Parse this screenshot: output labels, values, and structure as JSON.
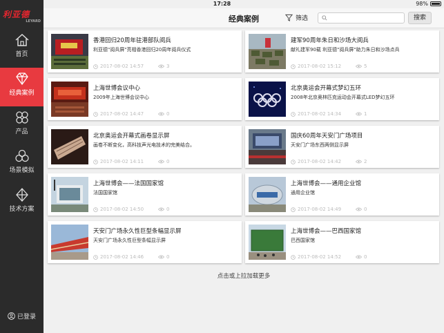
{
  "status": {
    "carrier": "iPad",
    "time": "17:28",
    "battery": "98%"
  },
  "brand": {
    "name_cn": "利亚德",
    "name_en": "LEYARD"
  },
  "sidebar": {
    "items": [
      {
        "label": "首页",
        "icon": "home-icon"
      },
      {
        "label": "经典案例",
        "icon": "diamond-icon",
        "active": true
      },
      {
        "label": "产品",
        "icon": "grid-flower-icon"
      },
      {
        "label": "场景模拟",
        "icon": "circles-icon"
      },
      {
        "label": "技术方案",
        "icon": "layers-icon"
      }
    ],
    "login_label": "已登录"
  },
  "header": {
    "title": "经典案例",
    "filter_label": "筛选",
    "search_placeholder": "",
    "search_button": "搜索"
  },
  "cards": [
    {
      "title": "香港回归20周年驻港部队阅兵",
      "desc": "利亚德\"阅兵屏\"亮相香港回归20周年阅兵仪式",
      "date": "2017-08-02 14:57",
      "views": "3",
      "thumb": "parade-hk"
    },
    {
      "title": "建军90周年朱日和沙场大阅兵",
      "desc": "献礼建军90载 利亚德\"阅兵屏\"助力朱日和沙场点兵",
      "date": "2017-08-02 15:12",
      "views": "5",
      "thumb": "tanks"
    },
    {
      "title": "上海世博会议中心",
      "desc": "2009年上海世博会议中心",
      "date": "2017-08-02 14:47",
      "views": "0",
      "thumb": "conference"
    },
    {
      "title": "北京奥运会开幕式梦幻五环",
      "desc": "2008年北京奥林匹克运动会开幕式LED梦幻五环",
      "date": "2017-08-02 14:34",
      "views": "1",
      "thumb": "olympic-rings"
    },
    {
      "title": "北京奥运会开幕式画卷显示屏",
      "desc": "画卷不断变化，高科技声光电技术的完美结合。",
      "date": "2017-08-02 14:11",
      "views": "0",
      "thumb": "scroll"
    },
    {
      "title": "国庆60周年天安门广场项目",
      "desc": "天安门广场东西两侧显示屏",
      "date": "2017-08-02 14:42",
      "views": "2",
      "thumb": "tiananmen"
    },
    {
      "title": "上海世博会——法国国家馆",
      "desc": "法国国家馆",
      "date": "2017-08-02 14:50",
      "views": "0",
      "thumb": "france-pavilion"
    },
    {
      "title": "上海世博会——通用企业馆",
      "desc": "通用企业馆",
      "date": "2017-08-02 14:49",
      "views": "0",
      "thumb": "gm-pavilion"
    },
    {
      "title": "天安门广场永久性巨型条幅显示屏",
      "desc": "天安门广场永久性巨型条幅显示屏",
      "date": "2017-08-02 14:46",
      "views": "0",
      "thumb": "banner"
    },
    {
      "title": "上海世博会——巴西国家馆",
      "desc": "巴西国家馆",
      "date": "2017-08-02 14:52",
      "views": "0",
      "thumb": "brazil-pavilion"
    }
  ],
  "load_more": "点击或上拉加载更多",
  "colors": {
    "sidebar_bg": "#2b2b2b",
    "accent": "#e83a40"
  }
}
